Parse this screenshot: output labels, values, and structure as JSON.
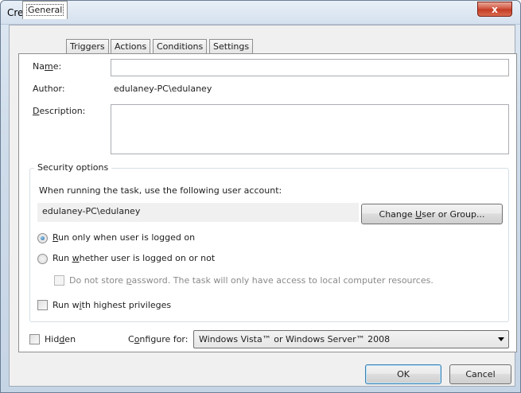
{
  "window": {
    "title": "Create Task",
    "close_glyph": "x"
  },
  "tabs": [
    {
      "label": "General"
    },
    {
      "label": "Triggers"
    },
    {
      "label": "Actions"
    },
    {
      "label": "Conditions"
    },
    {
      "label": "Settings"
    }
  ],
  "general": {
    "name_label_pre": "Na",
    "name_label_accel": "m",
    "name_label_post": "e:",
    "name_value": "",
    "author_label": "Author:",
    "author_value": "edulaney-PC\\edulaney",
    "description_label_accel": "D",
    "description_label_post": "escription:",
    "description_value": ""
  },
  "security": {
    "group_title": "Security options",
    "account_prompt": "When running the task, use the following user account:",
    "account_value": "edulaney-PC\\edulaney",
    "change_button_pre": "Change ",
    "change_button_accel": "U",
    "change_button_post": "ser or Group...",
    "radio_logged_on_accel": "R",
    "radio_logged_on_post": "un only when user is logged on",
    "radio_logged_on_selected": true,
    "radio_whether_pre": "Run ",
    "radio_whether_accel": "w",
    "radio_whether_post": "hether user is logged on or not",
    "no_store_pre": "Do not store ",
    "no_store_accel": "p",
    "no_store_post": "assword.  The task will only have access to local computer resources.",
    "highest_pre": "Run w",
    "highest_accel": "i",
    "highest_post": "th highest privileges"
  },
  "footer": {
    "hidden_pre": "Hid",
    "hidden_accel": "d",
    "hidden_post": "en",
    "configure_pre": "C",
    "configure_accel": "o",
    "configure_post": "nfigure for:",
    "configure_value": "Windows Vista™ or Windows Server™ 2008",
    "ok_label": "OK",
    "cancel_label": "Cancel"
  },
  "colors": {
    "accent": "#3c7fb1",
    "close_button": "#c33b23"
  }
}
